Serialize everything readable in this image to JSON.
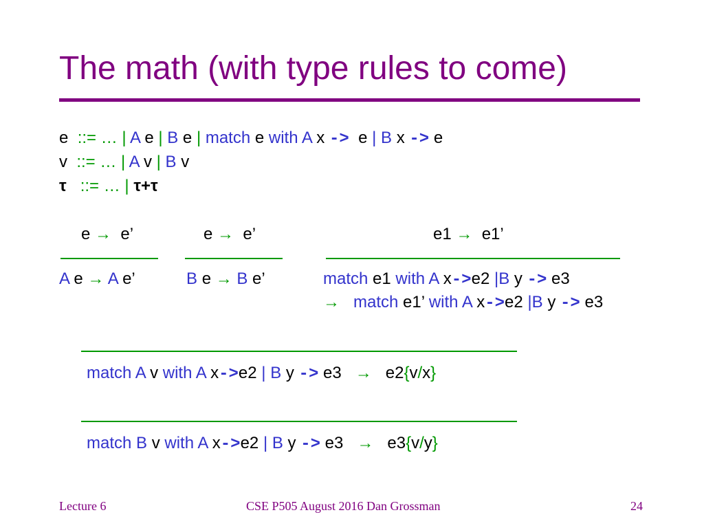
{
  "slide": {
    "title": "The math (with type rules to come)",
    "footer": {
      "left": "Lecture 6",
      "center": "CSE P505 August 2016  Dan Grossman",
      "page": "24"
    }
  },
  "grammar": [
    [
      {
        "t": "e  ",
        "c": "k"
      },
      {
        "t": "::= … ",
        "c": "g"
      },
      {
        "t": "| ",
        "c": "g"
      },
      {
        "t": "A ",
        "c": "b"
      },
      {
        "t": "e ",
        "c": "k"
      },
      {
        "t": "| ",
        "c": "g"
      },
      {
        "t": "B ",
        "c": "b"
      },
      {
        "t": "e ",
        "c": "k"
      },
      {
        "t": "| ",
        "c": "g"
      },
      {
        "t": "match ",
        "c": "b"
      },
      {
        "t": "e ",
        "c": "k"
      },
      {
        "t": "with A ",
        "c": "b"
      },
      {
        "t": "x ",
        "c": "k"
      },
      {
        "t": "->",
        "c": "b mono"
      },
      {
        "t": "  e ",
        "c": "k"
      },
      {
        "t": "| ",
        "c": "b"
      },
      {
        "t": "B ",
        "c": "b"
      },
      {
        "t": "x ",
        "c": "k"
      },
      {
        "t": "->",
        "c": "b mono"
      },
      {
        "t": " e",
        "c": "k"
      }
    ],
    [
      {
        "t": "v  ",
        "c": "k"
      },
      {
        "t": "::= … ",
        "c": "g"
      },
      {
        "t": "| ",
        "c": "g"
      },
      {
        "t": "A ",
        "c": "b"
      },
      {
        "t": "v ",
        "c": "k"
      },
      {
        "t": "| ",
        "c": "g"
      },
      {
        "t": "B ",
        "c": "b"
      },
      {
        "t": "v",
        "c": "k"
      }
    ],
    [
      {
        "t": "τ   ",
        "c": "k bold"
      },
      {
        "t": "::= … ",
        "c": "g"
      },
      {
        "t": "| ",
        "c": "g"
      },
      {
        "t": "τ+τ",
        "c": "k bold"
      }
    ]
  ],
  "rules": {
    "rule_a": {
      "premise": [
        {
          "t": "e ",
          "c": "k"
        },
        {
          "t": "→",
          "c": "g"
        },
        {
          "t": "  e’",
          "c": "k"
        }
      ],
      "conclusion": [
        {
          "t": "A ",
          "c": "b"
        },
        {
          "t": "e ",
          "c": "k"
        },
        {
          "t": "→",
          "c": "g"
        },
        {
          "t": " A ",
          "c": "b"
        },
        {
          "t": "e’",
          "c": "k"
        }
      ]
    },
    "rule_b": {
      "premise": [
        {
          "t": "e ",
          "c": "k"
        },
        {
          "t": "→",
          "c": "g"
        },
        {
          "t": "  e’",
          "c": "k"
        }
      ],
      "conclusion": [
        {
          "t": "B ",
          "c": "b"
        },
        {
          "t": "e ",
          "c": "k"
        },
        {
          "t": "→",
          "c": "g"
        },
        {
          "t": " B ",
          "c": "b"
        },
        {
          "t": "e’",
          "c": "k"
        }
      ]
    },
    "rule_match": {
      "premise": [
        {
          "t": "e1 ",
          "c": "k"
        },
        {
          "t": "→",
          "c": "g"
        },
        {
          "t": "  e1’",
          "c": "k"
        }
      ],
      "conclusion1": [
        {
          "t": "match ",
          "c": "b"
        },
        {
          "t": "e1 ",
          "c": "k"
        },
        {
          "t": "with A ",
          "c": "b"
        },
        {
          "t": "x",
          "c": "k"
        },
        {
          "t": "->",
          "c": "b mono"
        },
        {
          "t": "e2 ",
          "c": "k"
        },
        {
          "t": "|B ",
          "c": "b"
        },
        {
          "t": "y ",
          "c": "k"
        },
        {
          "t": "->",
          "c": "b mono"
        },
        {
          "t": " e3",
          "c": "k"
        }
      ],
      "conclusion2": [
        {
          "t": "→",
          "c": "g"
        },
        {
          "t": "   match ",
          "c": "b"
        },
        {
          "t": "e1’ ",
          "c": "k"
        },
        {
          "t": "with A ",
          "c": "b"
        },
        {
          "t": "x",
          "c": "k"
        },
        {
          "t": "->",
          "c": "b mono"
        },
        {
          "t": "e2 ",
          "c": "k"
        },
        {
          "t": "|B ",
          "c": "b"
        },
        {
          "t": "y ",
          "c": "k"
        },
        {
          "t": "->",
          "c": "b mono"
        },
        {
          "t": " e3",
          "c": "k"
        }
      ]
    },
    "rule_match_a": {
      "conclusion": [
        {
          "t": "match A ",
          "c": "b"
        },
        {
          "t": "v ",
          "c": "k"
        },
        {
          "t": "with A ",
          "c": "b"
        },
        {
          "t": "x",
          "c": "k"
        },
        {
          "t": "->",
          "c": "b mono"
        },
        {
          "t": "e2 ",
          "c": "k"
        },
        {
          "t": "| B ",
          "c": "b"
        },
        {
          "t": "y ",
          "c": "k"
        },
        {
          "t": "->",
          "c": "b mono"
        },
        {
          "t": " e3   ",
          "c": "k"
        },
        {
          "t": "→",
          "c": "g"
        },
        {
          "t": "   e2",
          "c": "k"
        },
        {
          "t": "{",
          "c": "g"
        },
        {
          "t": "v",
          "c": "k"
        },
        {
          "t": "/",
          "c": "g"
        },
        {
          "t": "x",
          "c": "k"
        },
        {
          "t": "}",
          "c": "g"
        }
      ]
    },
    "rule_match_b": {
      "conclusion": [
        {
          "t": "match B ",
          "c": "b"
        },
        {
          "t": "v ",
          "c": "k"
        },
        {
          "t": "with A ",
          "c": "b"
        },
        {
          "t": "x",
          "c": "k"
        },
        {
          "t": "->",
          "c": "b mono"
        },
        {
          "t": "e2 ",
          "c": "k"
        },
        {
          "t": "| B ",
          "c": "b"
        },
        {
          "t": "y ",
          "c": "k"
        },
        {
          "t": "->",
          "c": "b mono"
        },
        {
          "t": " e3   ",
          "c": "k"
        },
        {
          "t": "→",
          "c": "g"
        },
        {
          "t": "   e3",
          "c": "k"
        },
        {
          "t": "{",
          "c": "g"
        },
        {
          "t": "v",
          "c": "k"
        },
        {
          "t": "/",
          "c": "g"
        },
        {
          "t": "y",
          "c": "k"
        },
        {
          "t": "}",
          "c": "g"
        }
      ]
    }
  },
  "colors": {
    "title": "#800080",
    "keyword_blue": "#3333cc",
    "meta_green": "#009900",
    "text_black": "#000000"
  }
}
